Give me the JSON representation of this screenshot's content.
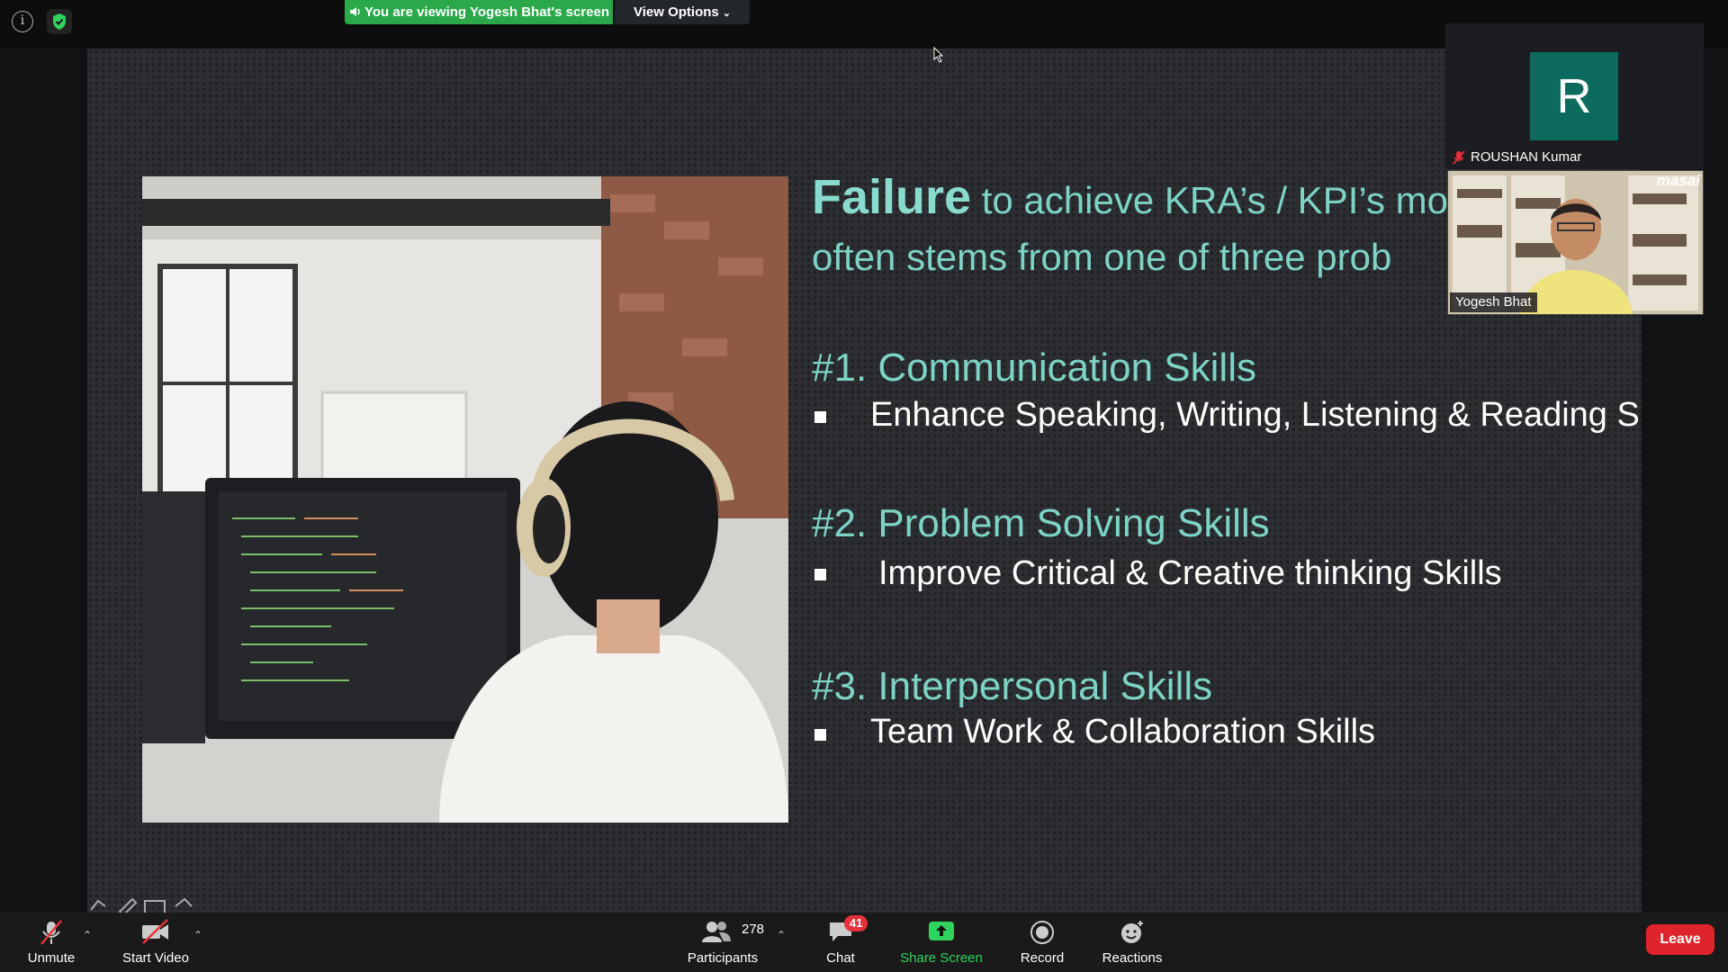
{
  "meeting": {
    "share_banner": "You are viewing Yogesh Bhat's screen",
    "view_options": "View Options"
  },
  "slide": {
    "heading_strong": "Failure",
    "heading_rest": " to achieve KRA’s / KPI’s mo",
    "heading_line2": "often stems from one of three prob",
    "skills": [
      {
        "title": "#1. Communication Skills",
        "detail": "Enhance Speaking, Writing, Listening & Reading Skills"
      },
      {
        "title": "#2. Problem Solving Skills",
        "detail": "Improve Critical & Creative thinking Skills"
      },
      {
        "title": "#3. Interpersonal Skills",
        "detail": "Team Work & Collaboration Skills"
      }
    ]
  },
  "participants_panel": {
    "tile1": {
      "initial": "R",
      "name": "ROUSHAN Kumar"
    },
    "tile2": {
      "name": "Yogesh Bhat",
      "logo": "masai"
    }
  },
  "toolbar": {
    "unmute": "Unmute",
    "start_video": "Start Video",
    "participants": "Participants",
    "participants_count": "278",
    "chat": "Chat",
    "chat_badge": "41",
    "share_screen": "Share Screen",
    "record": "Record",
    "reactions": "Reactions",
    "leave": "Leave"
  },
  "colors": {
    "banner_green": "#2aa84a",
    "slide_accent": "#7dd3c4",
    "leave_red": "#e0242b",
    "share_green": "#2fd35e"
  }
}
